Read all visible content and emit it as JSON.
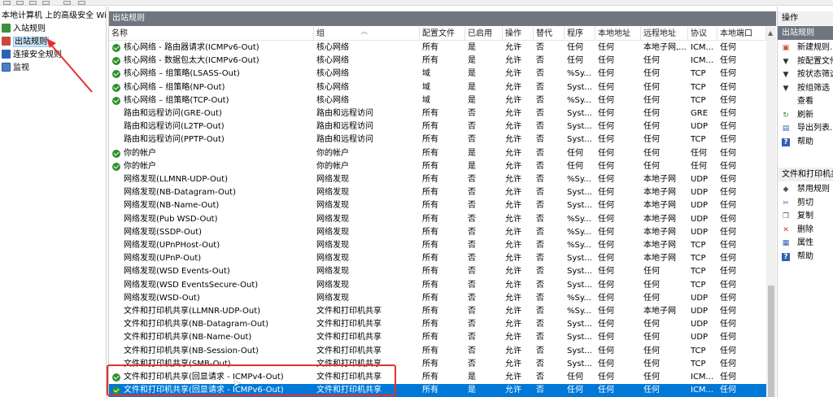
{
  "tree": {
    "root": "本地计算机 上的高级安全 Wind",
    "items": [
      {
        "label": "入站规则",
        "icon": "inbound-rules-icon"
      },
      {
        "label": "出站规则",
        "icon": "outbound-rules-icon"
      },
      {
        "label": "连接安全规则",
        "icon": "connection-security-icon"
      },
      {
        "label": "监视",
        "icon": "monitor-icon"
      }
    ]
  },
  "center": {
    "title": "出站规则",
    "columns": [
      "名称",
      "组",
      "配置文件",
      "已启用",
      "操作",
      "替代",
      "程序",
      "本地地址",
      "远程地址",
      "协议",
      "本地端口"
    ],
    "rows": [
      {
        "enabled_icon": true,
        "cells": [
          "核心网络 - 路由器请求(ICMPv6-Out)",
          "核心网络",
          "所有",
          "是",
          "允许",
          "否",
          "任何",
          "任何",
          "本地子网,...",
          "ICM...",
          "任何"
        ]
      },
      {
        "enabled_icon": true,
        "cells": [
          "核心网络 - 数据包太大(ICMPv6-Out)",
          "核心网络",
          "所有",
          "是",
          "允许",
          "否",
          "任何",
          "任何",
          "任何",
          "ICM...",
          "任何"
        ]
      },
      {
        "enabled_icon": true,
        "cells": [
          "核心网络 – 组策略(LSASS-Out)",
          "核心网络",
          "域",
          "是",
          "允许",
          "否",
          "%Sy...",
          "任何",
          "任何",
          "TCP",
          "任何"
        ]
      },
      {
        "enabled_icon": true,
        "cells": [
          "核心网络 – 组策略(NP-Out)",
          "核心网络",
          "域",
          "是",
          "允许",
          "否",
          "Syst...",
          "任何",
          "任何",
          "TCP",
          "任何"
        ]
      },
      {
        "enabled_icon": true,
        "cells": [
          "核心网络 – 组策略(TCP-Out)",
          "核心网络",
          "域",
          "是",
          "允许",
          "否",
          "%Sy...",
          "任何",
          "任何",
          "TCP",
          "任何"
        ]
      },
      {
        "enabled_icon": false,
        "cells": [
          "路由和远程访问(GRE-Out)",
          "路由和远程访问",
          "所有",
          "否",
          "允许",
          "否",
          "Syst...",
          "任何",
          "任何",
          "GRE",
          "任何"
        ]
      },
      {
        "enabled_icon": false,
        "cells": [
          "路由和远程访问(L2TP-Out)",
          "路由和远程访问",
          "所有",
          "否",
          "允许",
          "否",
          "Syst...",
          "任何",
          "任何",
          "UDP",
          "任何"
        ]
      },
      {
        "enabled_icon": false,
        "cells": [
          "路由和远程访问(PPTP-Out)",
          "路由和远程访问",
          "所有",
          "否",
          "允许",
          "否",
          "Syst...",
          "任何",
          "任何",
          "TCP",
          "任何"
        ]
      },
      {
        "enabled_icon": true,
        "cells": [
          "你的帐户",
          "你的帐户",
          "所有",
          "是",
          "允许",
          "否",
          "任何",
          "任何",
          "任何",
          "任何",
          "任何"
        ]
      },
      {
        "enabled_icon": true,
        "cells": [
          "你的帐户",
          "你的帐户",
          "所有",
          "是",
          "允许",
          "否",
          "任何",
          "任何",
          "任何",
          "任何",
          "任何"
        ]
      },
      {
        "enabled_icon": false,
        "cells": [
          "网络发现(LLMNR-UDP-Out)",
          "网络发现",
          "所有",
          "否",
          "允许",
          "否",
          "%Sy...",
          "任何",
          "本地子网",
          "UDP",
          "任何"
        ]
      },
      {
        "enabled_icon": false,
        "cells": [
          "网络发现(NB-Datagram-Out)",
          "网络发现",
          "所有",
          "否",
          "允许",
          "否",
          "Syst...",
          "任何",
          "本地子网",
          "UDP",
          "任何"
        ]
      },
      {
        "enabled_icon": false,
        "cells": [
          "网络发现(NB-Name-Out)",
          "网络发现",
          "所有",
          "否",
          "允许",
          "否",
          "Syst...",
          "任何",
          "本地子网",
          "UDP",
          "任何"
        ]
      },
      {
        "enabled_icon": false,
        "cells": [
          "网络发现(Pub WSD-Out)",
          "网络发现",
          "所有",
          "否",
          "允许",
          "否",
          "%Sy...",
          "任何",
          "本地子网",
          "UDP",
          "任何"
        ]
      },
      {
        "enabled_icon": false,
        "cells": [
          "网络发现(SSDP-Out)",
          "网络发现",
          "所有",
          "否",
          "允许",
          "否",
          "%Sy...",
          "任何",
          "本地子网",
          "UDP",
          "任何"
        ]
      },
      {
        "enabled_icon": false,
        "cells": [
          "网络发现(UPnPHost-Out)",
          "网络发现",
          "所有",
          "否",
          "允许",
          "否",
          "%Sy...",
          "任何",
          "本地子网",
          "TCP",
          "任何"
        ]
      },
      {
        "enabled_icon": false,
        "cells": [
          "网络发现(UPnP-Out)",
          "网络发现",
          "所有",
          "否",
          "允许",
          "否",
          "Syst...",
          "任何",
          "本地子网",
          "TCP",
          "任何"
        ]
      },
      {
        "enabled_icon": false,
        "cells": [
          "网络发现(WSD Events-Out)",
          "网络发现",
          "所有",
          "否",
          "允许",
          "否",
          "Syst...",
          "任何",
          "任何",
          "TCP",
          "任何"
        ]
      },
      {
        "enabled_icon": false,
        "cells": [
          "网络发现(WSD EventsSecure-Out)",
          "网络发现",
          "所有",
          "否",
          "允许",
          "否",
          "Syst...",
          "任何",
          "任何",
          "TCP",
          "任何"
        ]
      },
      {
        "enabled_icon": false,
        "cells": [
          "网络发现(WSD-Out)",
          "网络发现",
          "所有",
          "否",
          "允许",
          "否",
          "%Sy...",
          "任何",
          "任何",
          "UDP",
          "任何"
        ]
      },
      {
        "enabled_icon": false,
        "cells": [
          "文件和打印机共享(LLMNR-UDP-Out)",
          "文件和打印机共享",
          "所有",
          "否",
          "允许",
          "否",
          "%Sy...",
          "任何",
          "本地子网",
          "UDP",
          "任何"
        ]
      },
      {
        "enabled_icon": false,
        "cells": [
          "文件和打印机共享(NB-Datagram-Out)",
          "文件和打印机共享",
          "所有",
          "否",
          "允许",
          "否",
          "Syst...",
          "任何",
          "任何",
          "UDP",
          "任何"
        ]
      },
      {
        "enabled_icon": false,
        "cells": [
          "文件和打印机共享(NB-Name-Out)",
          "文件和打印机共享",
          "所有",
          "否",
          "允许",
          "否",
          "Syst...",
          "任何",
          "任何",
          "UDP",
          "任何"
        ]
      },
      {
        "enabled_icon": false,
        "cells": [
          "文件和打印机共享(NB-Session-Out)",
          "文件和打印机共享",
          "所有",
          "否",
          "允许",
          "否",
          "Syst...",
          "任何",
          "任何",
          "TCP",
          "任何"
        ]
      },
      {
        "enabled_icon": false,
        "cells": [
          "文件和打印机共享(SMB-Out)",
          "文件和打印机共享",
          "所有",
          "否",
          "允许",
          "否",
          "Syst...",
          "任何",
          "任何",
          "TCP",
          "任何"
        ]
      },
      {
        "enabled_icon": true,
        "cells": [
          "文件和打印机共享(回显请求 - ICMPv4-Out)",
          "文件和打印机共享",
          "所有",
          "是",
          "允许",
          "否",
          "任何",
          "任何",
          "任何",
          "ICM...",
          "任何"
        ]
      },
      {
        "enabled_icon": true,
        "selected": true,
        "cells": [
          "文件和打印机共享(回显请求 - ICMPv6-Out)",
          "文件和打印机共享",
          "所有",
          "是",
          "允许",
          "否",
          "任何",
          "任何",
          "任何",
          "ICM...",
          "任何"
        ]
      }
    ]
  },
  "actions": {
    "header": "操作",
    "section1": "出站规则",
    "items1": [
      {
        "label": "新建规则...",
        "icon": "new-rule-icon"
      },
      {
        "label": "按配置文件筛选",
        "icon": "filter-icon"
      },
      {
        "label": "按状态筛选",
        "icon": "filter-icon"
      },
      {
        "label": "按组筛选",
        "icon": "filter-icon"
      },
      {
        "label": "查看",
        "icon": ""
      },
      {
        "label": "刷新",
        "icon": "refresh-icon"
      },
      {
        "label": "导出列表...",
        "icon": "export-icon"
      },
      {
        "label": "帮助",
        "icon": "help-icon"
      }
    ],
    "section2": "文件和打印机共享",
    "items2": [
      {
        "label": "禁用规则",
        "icon": "disable-icon"
      },
      {
        "label": "剪切",
        "icon": "cut-icon"
      },
      {
        "label": "复制",
        "icon": "copy-icon"
      },
      {
        "label": "删除",
        "icon": "delete-icon"
      },
      {
        "label": "属性",
        "icon": "properties-icon"
      },
      {
        "label": "帮助",
        "icon": "help-icon"
      }
    ]
  },
  "colors": {
    "accent": "#0078d7",
    "header_dark": "#6f7680",
    "annotation": "#e53030",
    "enabled_green": "#2f8f2f"
  }
}
